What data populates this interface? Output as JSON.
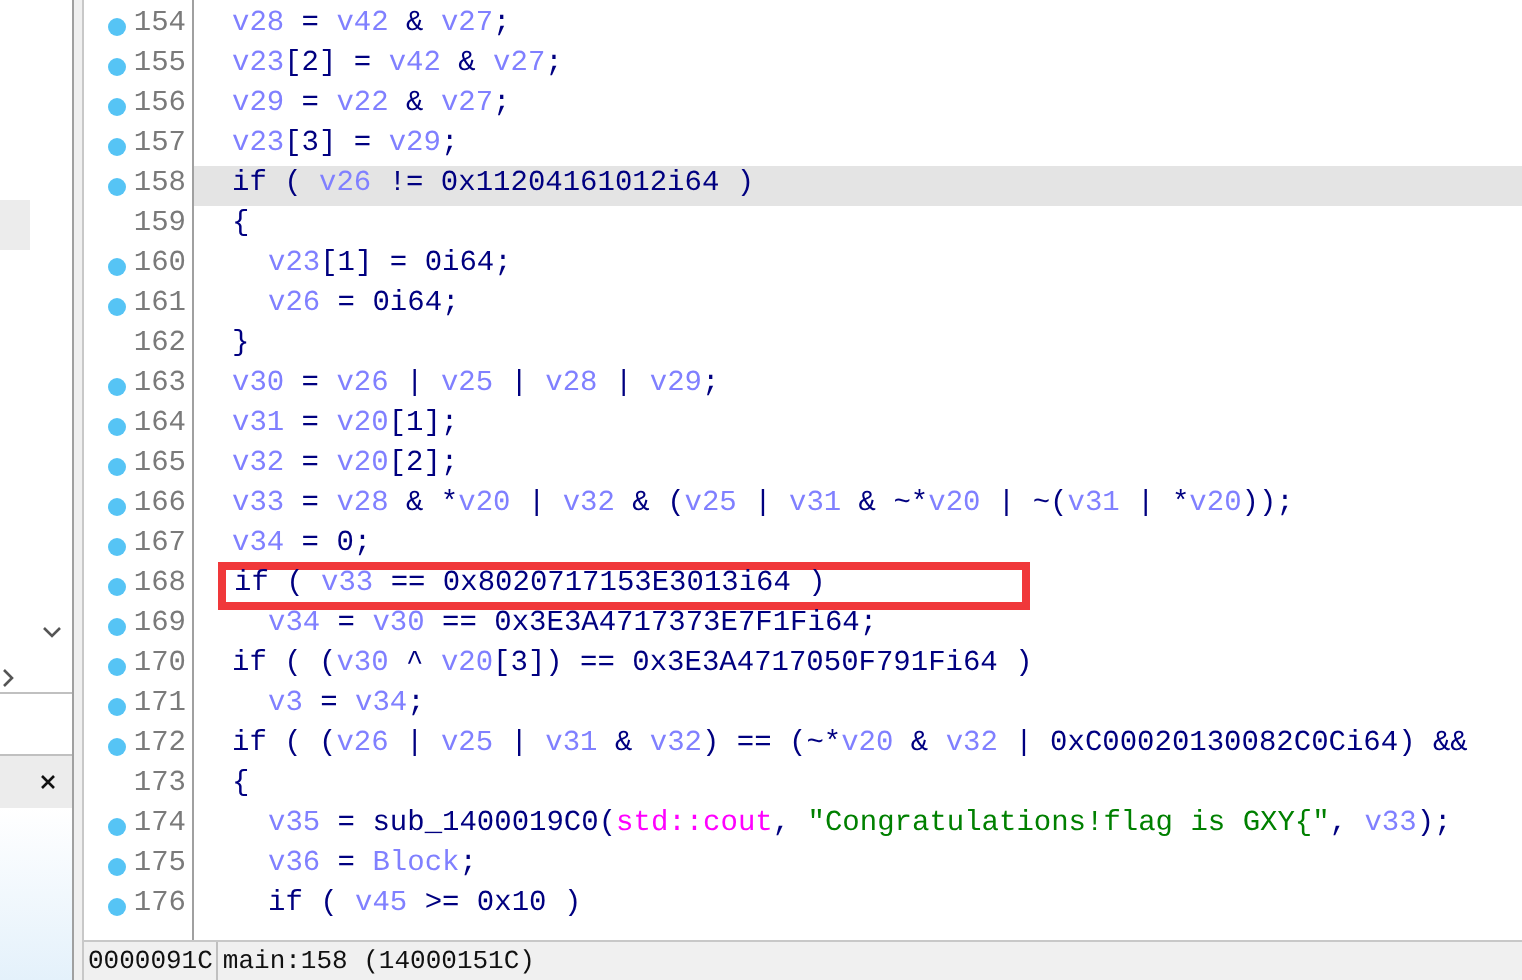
{
  "code_lines": [
    {
      "number": "154",
      "breakpoint": true,
      "selected": false,
      "boxed": false,
      "kind": "outer",
      "tokens": [
        {
          "kind": "var",
          "text": "v28"
        },
        {
          "kind": "plain",
          "text": " = "
        },
        {
          "kind": "var",
          "text": "v42"
        },
        {
          "kind": "plain",
          "text": " & "
        },
        {
          "kind": "var",
          "text": "v27"
        },
        {
          "kind": "plain",
          "text": ";"
        }
      ]
    },
    {
      "number": "155",
      "breakpoint": true,
      "selected": false,
      "boxed": false,
      "kind": "outer",
      "tokens": [
        {
          "kind": "var",
          "text": "v23"
        },
        {
          "kind": "plain",
          "text": "[2] = "
        },
        {
          "kind": "var",
          "text": "v42"
        },
        {
          "kind": "plain",
          "text": " & "
        },
        {
          "kind": "var",
          "text": "v27"
        },
        {
          "kind": "plain",
          "text": ";"
        }
      ]
    },
    {
      "number": "156",
      "breakpoint": true,
      "selected": false,
      "boxed": false,
      "kind": "outer",
      "tokens": [
        {
          "kind": "var",
          "text": "v29"
        },
        {
          "kind": "plain",
          "text": " = "
        },
        {
          "kind": "var",
          "text": "v22"
        },
        {
          "kind": "plain",
          "text": " & "
        },
        {
          "kind": "var",
          "text": "v27"
        },
        {
          "kind": "plain",
          "text": ";"
        }
      ]
    },
    {
      "number": "157",
      "breakpoint": true,
      "selected": false,
      "boxed": false,
      "kind": "outer",
      "tokens": [
        {
          "kind": "var",
          "text": "v23"
        },
        {
          "kind": "plain",
          "text": "[3] = "
        },
        {
          "kind": "var",
          "text": "v29"
        },
        {
          "kind": "plain",
          "text": ";"
        }
      ]
    },
    {
      "number": "158",
      "breakpoint": true,
      "selected": true,
      "boxed": false,
      "kind": "outer",
      "tokens": [
        {
          "kind": "plain",
          "text": "if ( "
        },
        {
          "kind": "var",
          "text": "v26"
        },
        {
          "kind": "plain",
          "text": " != 0x11204161012i64 )"
        }
      ]
    },
    {
      "number": "159",
      "breakpoint": false,
      "selected": false,
      "boxed": false,
      "kind": "outer",
      "tokens": [
        {
          "kind": "plain",
          "text": "{"
        }
      ]
    },
    {
      "number": "160",
      "breakpoint": true,
      "selected": false,
      "boxed": false,
      "kind": "inner",
      "tokens": [
        {
          "kind": "var",
          "text": "v23"
        },
        {
          "kind": "plain",
          "text": "[1] = 0i64;"
        }
      ]
    },
    {
      "number": "161",
      "breakpoint": true,
      "selected": false,
      "boxed": false,
      "kind": "inner",
      "tokens": [
        {
          "kind": "var",
          "text": "v26"
        },
        {
          "kind": "plain",
          "text": " = 0i64;"
        }
      ]
    },
    {
      "number": "162",
      "breakpoint": false,
      "selected": false,
      "boxed": false,
      "kind": "outer",
      "tokens": [
        {
          "kind": "plain",
          "text": "}"
        }
      ]
    },
    {
      "number": "163",
      "breakpoint": true,
      "selected": false,
      "boxed": false,
      "kind": "outer",
      "tokens": [
        {
          "kind": "var",
          "text": "v30"
        },
        {
          "kind": "plain",
          "text": " = "
        },
        {
          "kind": "var",
          "text": "v26"
        },
        {
          "kind": "plain",
          "text": " | "
        },
        {
          "kind": "var",
          "text": "v25"
        },
        {
          "kind": "plain",
          "text": " | "
        },
        {
          "kind": "var",
          "text": "v28"
        },
        {
          "kind": "plain",
          "text": " | "
        },
        {
          "kind": "var",
          "text": "v29"
        },
        {
          "kind": "plain",
          "text": ";"
        }
      ]
    },
    {
      "number": "164",
      "breakpoint": true,
      "selected": false,
      "boxed": false,
      "kind": "outer",
      "tokens": [
        {
          "kind": "var",
          "text": "v31"
        },
        {
          "kind": "plain",
          "text": " = "
        },
        {
          "kind": "var",
          "text": "v20"
        },
        {
          "kind": "plain",
          "text": "[1];"
        }
      ]
    },
    {
      "number": "165",
      "breakpoint": true,
      "selected": false,
      "boxed": false,
      "kind": "outer",
      "tokens": [
        {
          "kind": "var",
          "text": "v32"
        },
        {
          "kind": "plain",
          "text": " = "
        },
        {
          "kind": "var",
          "text": "v20"
        },
        {
          "kind": "plain",
          "text": "[2];"
        }
      ]
    },
    {
      "number": "166",
      "breakpoint": true,
      "selected": false,
      "boxed": false,
      "kind": "outer",
      "tokens": [
        {
          "kind": "var",
          "text": "v33"
        },
        {
          "kind": "plain",
          "text": " = "
        },
        {
          "kind": "var",
          "text": "v28"
        },
        {
          "kind": "plain",
          "text": " & *"
        },
        {
          "kind": "var",
          "text": "v20"
        },
        {
          "kind": "plain",
          "text": " | "
        },
        {
          "kind": "var",
          "text": "v32"
        },
        {
          "kind": "plain",
          "text": " & ("
        },
        {
          "kind": "var",
          "text": "v25"
        },
        {
          "kind": "plain",
          "text": " | "
        },
        {
          "kind": "var",
          "text": "v31"
        },
        {
          "kind": "plain",
          "text": " & ~*"
        },
        {
          "kind": "var",
          "text": "v20"
        },
        {
          "kind": "plain",
          "text": " | ~("
        },
        {
          "kind": "var",
          "text": "v31"
        },
        {
          "kind": "plain",
          "text": " | *"
        },
        {
          "kind": "var",
          "text": "v20"
        },
        {
          "kind": "plain",
          "text": "));"
        }
      ]
    },
    {
      "number": "167",
      "breakpoint": true,
      "selected": false,
      "boxed": false,
      "kind": "outer",
      "tokens": [
        {
          "kind": "var",
          "text": "v34"
        },
        {
          "kind": "plain",
          "text": " = 0;"
        }
      ]
    },
    {
      "number": "168",
      "breakpoint": true,
      "selected": false,
      "boxed": true,
      "kind": "outer",
      "tokens": [
        {
          "kind": "plain",
          "text": "if ( "
        },
        {
          "kind": "var",
          "text": "v33"
        },
        {
          "kind": "plain",
          "text": " == 0x8020717153E3013i64 )"
        }
      ]
    },
    {
      "number": "169",
      "breakpoint": true,
      "selected": false,
      "boxed": false,
      "kind": "inner",
      "tokens": [
        {
          "kind": "var",
          "text": "v34"
        },
        {
          "kind": "plain",
          "text": " = "
        },
        {
          "kind": "var",
          "text": "v30"
        },
        {
          "kind": "plain",
          "text": " == 0x3E3A4717373E7F1Fi64;"
        }
      ]
    },
    {
      "number": "170",
      "breakpoint": true,
      "selected": false,
      "boxed": false,
      "kind": "outer",
      "tokens": [
        {
          "kind": "plain",
          "text": "if ( ("
        },
        {
          "kind": "var",
          "text": "v30"
        },
        {
          "kind": "plain",
          "text": " ^ "
        },
        {
          "kind": "var",
          "text": "v20"
        },
        {
          "kind": "plain",
          "text": "[3]) == 0x3E3A4717050F791Fi64 )"
        }
      ]
    },
    {
      "number": "171",
      "breakpoint": true,
      "selected": false,
      "boxed": false,
      "kind": "inner",
      "tokens": [
        {
          "kind": "var",
          "text": "v3"
        },
        {
          "kind": "plain",
          "text": " = "
        },
        {
          "kind": "var",
          "text": "v34"
        },
        {
          "kind": "plain",
          "text": ";"
        }
      ]
    },
    {
      "number": "172",
      "breakpoint": true,
      "selected": false,
      "boxed": false,
      "kind": "outer",
      "tokens": [
        {
          "kind": "plain",
          "text": "if ( ("
        },
        {
          "kind": "var",
          "text": "v26"
        },
        {
          "kind": "plain",
          "text": " | "
        },
        {
          "kind": "var",
          "text": "v25"
        },
        {
          "kind": "plain",
          "text": " | "
        },
        {
          "kind": "var",
          "text": "v31"
        },
        {
          "kind": "plain",
          "text": " & "
        },
        {
          "kind": "var",
          "text": "v32"
        },
        {
          "kind": "plain",
          "text": ") == (~*"
        },
        {
          "kind": "var",
          "text": "v20"
        },
        {
          "kind": "plain",
          "text": " & "
        },
        {
          "kind": "var",
          "text": "v32"
        },
        {
          "kind": "plain",
          "text": " | 0xC00020130082C0Ci64) &&"
        }
      ]
    },
    {
      "number": "173",
      "breakpoint": false,
      "selected": false,
      "boxed": false,
      "kind": "outer",
      "tokens": [
        {
          "kind": "plain",
          "text": "{"
        }
      ]
    },
    {
      "number": "174",
      "breakpoint": true,
      "selected": false,
      "boxed": false,
      "kind": "inner",
      "tokens": [
        {
          "kind": "var",
          "text": "v35"
        },
        {
          "kind": "plain",
          "text": " = sub_1400019C0("
        },
        {
          "kind": "lib",
          "text": "std::cout"
        },
        {
          "kind": "plain",
          "text": ", "
        },
        {
          "kind": "string",
          "text": "\"Congratulations!flag is GXY{\""
        },
        {
          "kind": "plain",
          "text": ", "
        },
        {
          "kind": "var",
          "text": "v33"
        },
        {
          "kind": "plain",
          "text": ");"
        }
      ]
    },
    {
      "number": "175",
      "breakpoint": true,
      "selected": false,
      "boxed": false,
      "kind": "inner",
      "tokens": [
        {
          "kind": "var",
          "text": "v36"
        },
        {
          "kind": "plain",
          "text": " = "
        },
        {
          "kind": "var",
          "text": "Block"
        },
        {
          "kind": "plain",
          "text": ";"
        }
      ]
    },
    {
      "number": "176",
      "breakpoint": true,
      "selected": false,
      "boxed": false,
      "kind": "inner",
      "tokens": [
        {
          "kind": "plain",
          "text": "if ( "
        },
        {
          "kind": "var",
          "text": "v45"
        },
        {
          "kind": "plain",
          "text": " >= 0x10 )"
        }
      ]
    }
  ],
  "status_bar": {
    "address": "0000091C",
    "location": "main:158 (14000151C)"
  }
}
